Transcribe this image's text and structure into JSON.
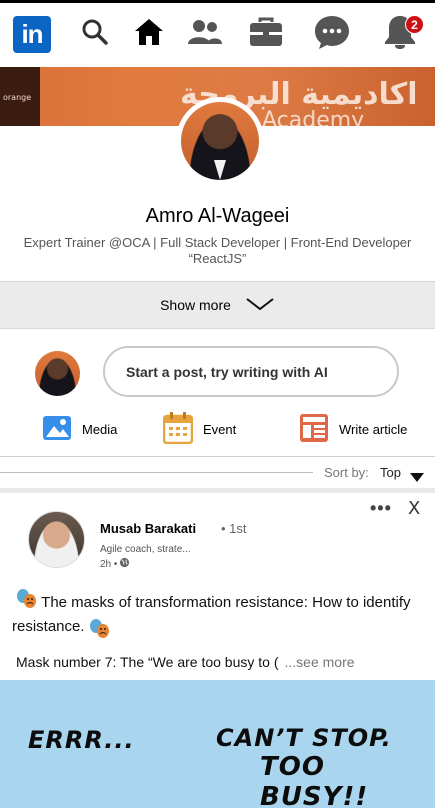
{
  "nav": {
    "logo_text": "in",
    "notification_count": "2",
    "icons": [
      "linkedin-logo",
      "search-icon",
      "home-icon",
      "my-network-icon",
      "jobs-icon",
      "messaging-icon",
      "notifications-icon"
    ]
  },
  "profile": {
    "banner_arabic": "اكاديمية البرمجة",
    "banner_english": "Academy",
    "banner_small": "orange",
    "name": "Amro Al-Wageei",
    "headline": "Expert Trainer @OCA | Full Stack Developer | Front-End Developer “ReactJS”",
    "show_more": "Show more"
  },
  "composer": {
    "placeholder": "Start a post, try writing with AI",
    "actions": [
      {
        "label": "Media",
        "icon": "media-icon",
        "color": "#378fe9"
      },
      {
        "label": "Event",
        "icon": "event-icon",
        "color": "#c37d16"
      },
      {
        "label": "Write article",
        "icon": "article-icon",
        "color": "#e06847"
      }
    ]
  },
  "sort": {
    "label": "Sort by:",
    "value": "Top"
  },
  "post": {
    "author": "Musab Barakati",
    "degree": "• 1st",
    "subtitle": "Agile coach, strate...",
    "time": "2h •",
    "text_line1": "The masks of transformation resistance: How to identify resistance.",
    "text_line2": "Mask number 7: The “We are too busy to (",
    "see_more": "...see more",
    "image_text_left": "ERRR...",
    "image_text_right1": "CAN’T STOP.",
    "image_text_right2": "TOO BUSY!!"
  },
  "colors": {
    "brand": "#0a66c2",
    "badge": "#cc1016",
    "banner": "#e07a3e"
  }
}
